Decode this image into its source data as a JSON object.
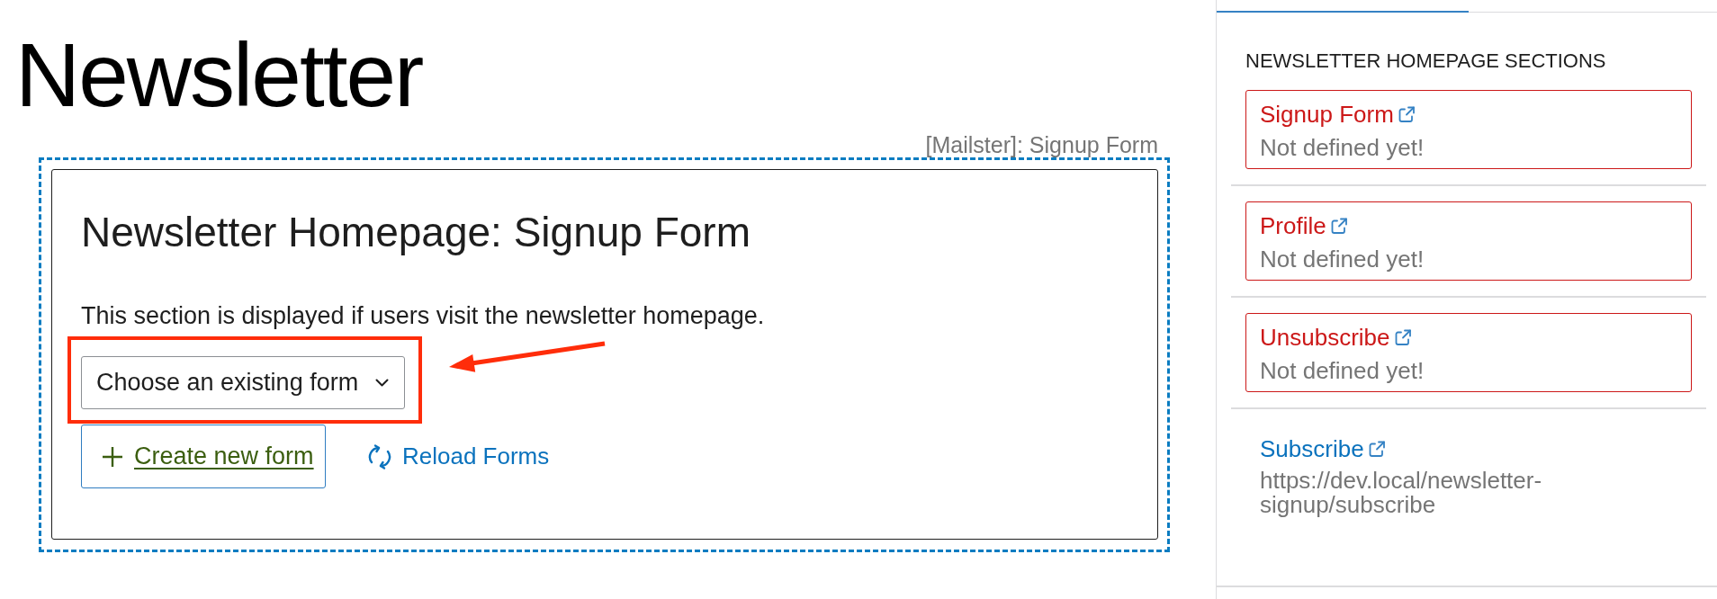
{
  "page": {
    "title": "Newsletter"
  },
  "block": {
    "label": "[Mailster]: Signup Form",
    "heading": "Newsletter Homepage: Signup Form",
    "description": "This section is displayed if users visit the newsletter homepage.",
    "form_select": {
      "value": "Choose an existing form"
    },
    "create_button": {
      "label": "Create new form"
    },
    "reload_link": {
      "label": "Reload Forms"
    }
  },
  "sidebar": {
    "tabs": [
      {
        "selected": true
      },
      {
        "selected": false
      }
    ],
    "heading": "NEWSLETTER HOMEPAGE SECTIONS",
    "sections": [
      {
        "title": "Signup Form",
        "defined": false,
        "detail": "Not defined yet!"
      },
      {
        "title": "Profile",
        "defined": false,
        "detail": "Not defined yet!"
      },
      {
        "title": "Unsubscribe",
        "defined": false,
        "detail": "Not defined yet!"
      },
      {
        "title": "Subscribe",
        "defined": true,
        "detail": "https://dev.local/newsletter-signup/subscribe"
      }
    ]
  }
}
